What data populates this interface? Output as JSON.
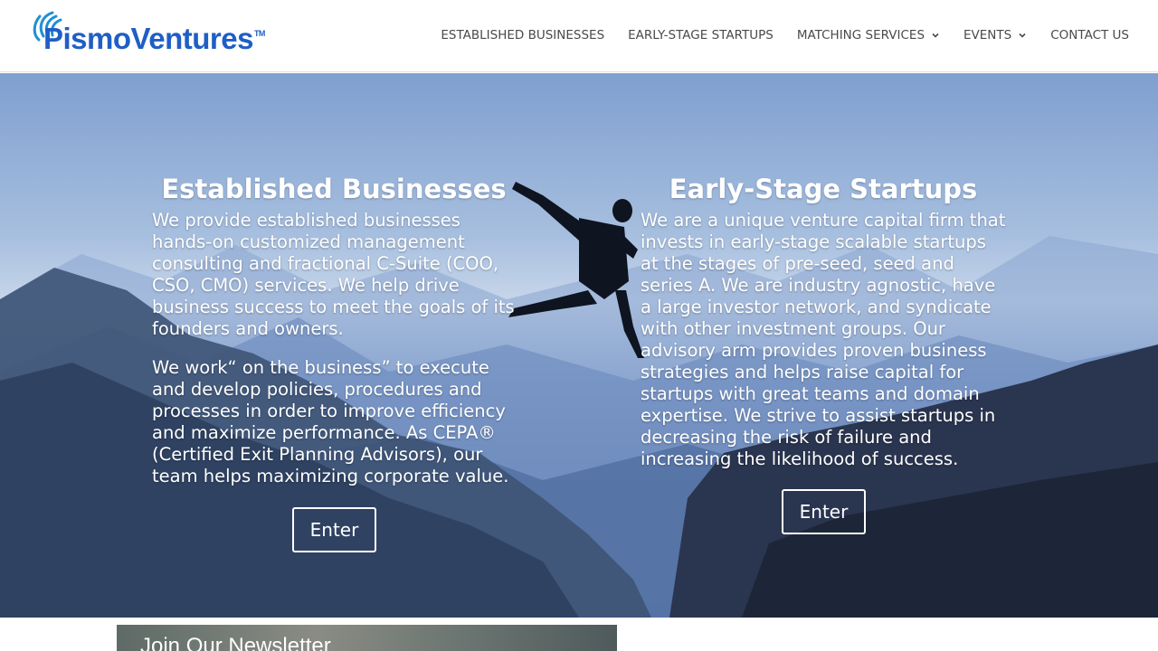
{
  "brand": {
    "logo_text": "PismoVentures",
    "trademark": "TM",
    "logo_color": "#1f5fc5"
  },
  "nav": {
    "items": [
      {
        "label": "ESTABLISHED BUSINESSES",
        "has_dropdown": false
      },
      {
        "label": "EARLY-STAGE STARTUPS",
        "has_dropdown": false
      },
      {
        "label": "MATCHING SERVICES",
        "has_dropdown": true
      },
      {
        "label": "EVENTS",
        "has_dropdown": true
      },
      {
        "label": "CONTACT US",
        "has_dropdown": false
      }
    ]
  },
  "hero": {
    "left": {
      "title": "Established Businesses",
      "paragraphs": [
        "We provide established businesses hands-on customized management consulting and fractional C-Suite (COO, CSO, CMO) services. We help drive business success to meet the goals of its founders and owners.",
        "We work“ on the business” to execute and develop policies, procedures and processes in order to improve efficiency and maximize performance. As CEPA® (Certified Exit Planning Advisors), our team helps maximizing corporate value."
      ],
      "button_label": "Enter"
    },
    "right": {
      "title": "Early-Stage Startups",
      "paragraphs": [
        "We are a unique venture capital firm that invests in early-stage scalable startups at the stages of pre-seed, seed and series A. We are industry agnostic, have a large investor network, and syndicate with other investment groups. Our advisory arm provides proven business strategies and helps raise capital for startups with great teams and domain expertise. We strive to assist startups in decreasing the risk of failure and increasing the likelihood of success."
      ],
      "button_label": "Enter"
    }
  },
  "newsletter": {
    "title": "Join Our Newsletter"
  },
  "colors": {
    "nav_text": "#4a4a4a",
    "hero_text": "#ffffff"
  }
}
